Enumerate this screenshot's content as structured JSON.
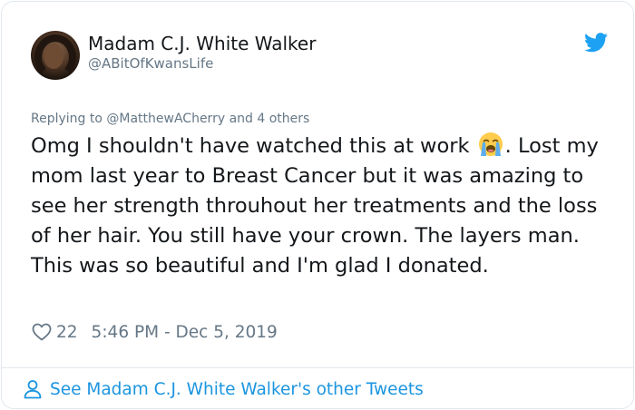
{
  "author": {
    "name": "Madam C.J. White Walker",
    "handle": "@ABitOfKwansLife"
  },
  "reply": {
    "prefix": "Replying to",
    "mention": "@MatthewACherry",
    "suffix": "and 4 others"
  },
  "tweet": {
    "text_before_emoji": "Omg I shouldn't have watched this at work ",
    "emoji": "loudly-crying-face",
    "text_after_emoji": ". Lost my mom last year to Breast Cancer but it was amazing to see her strength throuhout her treatments and the loss of her hair. You still have your crown. The layers man. This was so beautiful and I'm glad I donated."
  },
  "meta": {
    "likes": "22",
    "timestamp": "5:46 PM - Dec 5, 2019"
  },
  "footer": {
    "link_label": "See Madam C.J. White Walker's other Tweets"
  },
  "colors": {
    "twitter_blue": "#1da1f2",
    "link_blue": "#1b95e0",
    "secondary_text": "#657786",
    "border": "#e1e8ed"
  },
  "icons": [
    "twitter-bird-icon",
    "heart-icon",
    "person-icon"
  ]
}
